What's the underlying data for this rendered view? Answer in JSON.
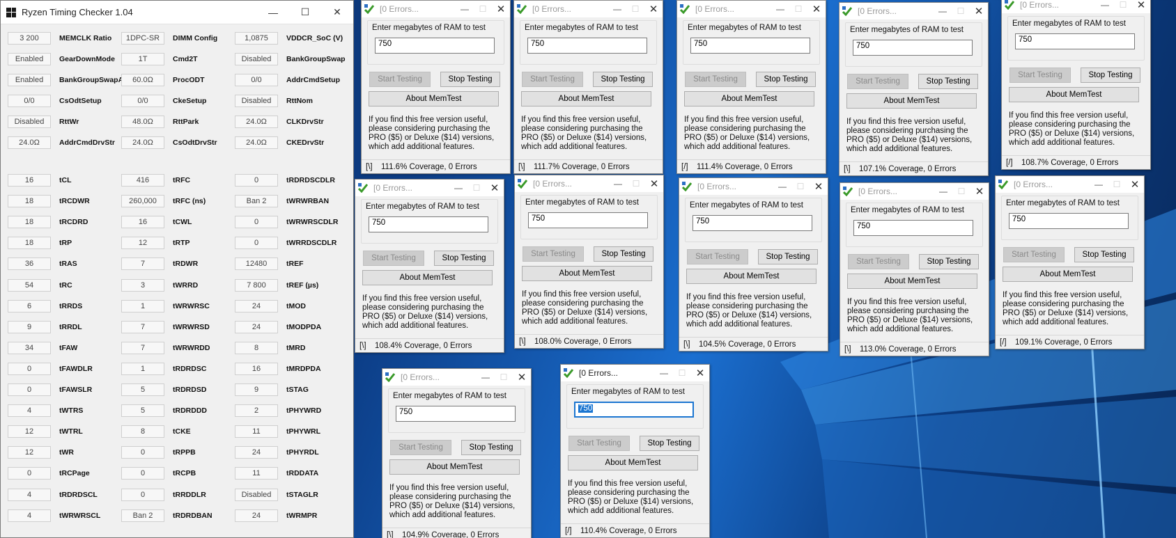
{
  "rtc": {
    "title": "Ryzen Timing Checker 1.04",
    "controls": {
      "minimize": "—",
      "maximize": "☐",
      "close": "✕"
    },
    "top_rows": [
      [
        {
          "v": "3 200",
          "n": "MEMCLK Ratio"
        },
        {
          "v": "1DPC-SR",
          "n": "DIMM Config"
        },
        {
          "v": "1,0875",
          "n": "VDDCR_SoC (V)"
        }
      ],
      [
        {
          "v": "Enabled",
          "n": "GearDownMode"
        },
        {
          "v": "1T",
          "n": "Cmd2T"
        },
        {
          "v": "Disabled",
          "n": "BankGroupSwap"
        }
      ],
      [
        {
          "v": "Enabled",
          "n": "BankGroupSwapAlt"
        },
        {
          "v": "60.0Ω",
          "n": "ProcODT"
        },
        {
          "v": "0/0",
          "n": "AddrCmdSetup"
        }
      ],
      [
        {
          "v": "0/0",
          "n": "CsOdtSetup"
        },
        {
          "v": "0/0",
          "n": "CkeSetup"
        },
        {
          "v": "Disabled",
          "n": "RttNom"
        }
      ],
      [
        {
          "v": "Disabled",
          "n": "RttWr"
        },
        {
          "v": "48.0Ω",
          "n": "RttPark"
        },
        {
          "v": "24.0Ω",
          "n": "CLKDrvStr"
        }
      ],
      [
        {
          "v": "24.0Ω",
          "n": "AddrCmdDrvStr"
        },
        {
          "v": "24.0Ω",
          "n": "CsOdtDrvStr"
        },
        {
          "v": "24.0Ω",
          "n": "CKEDrvStr"
        }
      ]
    ],
    "timing_rows": [
      [
        {
          "v": "16",
          "n": "tCL"
        },
        {
          "v": "416",
          "n": "tRFC"
        },
        {
          "v": "0",
          "n": "tRDRDSCDLR"
        }
      ],
      [
        {
          "v": "18",
          "n": "tRCDWR"
        },
        {
          "v": "260,000",
          "n": "tRFC (ns)"
        },
        {
          "v": "Ban 2",
          "n": "tWRWRBAN"
        }
      ],
      [
        {
          "v": "18",
          "n": "tRCDRD"
        },
        {
          "v": "16",
          "n": "tCWL"
        },
        {
          "v": "0",
          "n": "tWRWRSCDLR"
        }
      ],
      [
        {
          "v": "18",
          "n": "tRP"
        },
        {
          "v": "12",
          "n": "tRTP"
        },
        {
          "v": "0",
          "n": "tWRRDSCDLR"
        }
      ],
      [
        {
          "v": "36",
          "n": "tRAS"
        },
        {
          "v": "7",
          "n": "tRDWR"
        },
        {
          "v": "12480",
          "n": "tREF"
        }
      ],
      [
        {
          "v": "54",
          "n": "tRC"
        },
        {
          "v": "3",
          "n": "tWRRD"
        },
        {
          "v": "7 800",
          "n": "tREF (µs)"
        }
      ],
      [
        {
          "v": "6",
          "n": "tRRDS"
        },
        {
          "v": "1",
          "n": "tWRWRSC"
        },
        {
          "v": "24",
          "n": "tMOD"
        }
      ],
      [
        {
          "v": "9",
          "n": "tRRDL"
        },
        {
          "v": "7",
          "n": "tWRWRSD"
        },
        {
          "v": "24",
          "n": "tMODPDA"
        }
      ],
      [
        {
          "v": "34",
          "n": "tFAW"
        },
        {
          "v": "7",
          "n": "tWRWRDD"
        },
        {
          "v": "8",
          "n": "tMRD"
        }
      ],
      [
        {
          "v": "0",
          "n": "tFAWDLR"
        },
        {
          "v": "1",
          "n": "tRDRDSC"
        },
        {
          "v": "16",
          "n": "tMRDPDA"
        }
      ],
      [
        {
          "v": "0",
          "n": "tFAWSLR"
        },
        {
          "v": "5",
          "n": "tRDRDSD"
        },
        {
          "v": "9",
          "n": "tSTAG"
        }
      ],
      [
        {
          "v": "4",
          "n": "tWTRS"
        },
        {
          "v": "5",
          "n": "tRDRDDD"
        },
        {
          "v": "2",
          "n": "tPHYWRD"
        }
      ],
      [
        {
          "v": "12",
          "n": "tWTRL"
        },
        {
          "v": "8",
          "n": "tCKE"
        },
        {
          "v": "11",
          "n": "tPHYWRL"
        }
      ],
      [
        {
          "v": "12",
          "n": "tWR"
        },
        {
          "v": "0",
          "n": "tRPPB"
        },
        {
          "v": "24",
          "n": "tPHYRDL"
        }
      ],
      [
        {
          "v": "0",
          "n": "tRCPage"
        },
        {
          "v": "0",
          "n": "tRCPB"
        },
        {
          "v": "11",
          "n": "tRDDATA"
        }
      ],
      [
        {
          "v": "4",
          "n": "tRDRDSCL"
        },
        {
          "v": "0",
          "n": "tRRDDLR"
        },
        {
          "v": "Disabled",
          "n": "tSTAGLR"
        }
      ],
      [
        {
          "v": "4",
          "n": "tWRWRSCL"
        },
        {
          "v": "Ban 2",
          "n": "tRDRDBAN"
        },
        {
          "v": "24",
          "n": "tWRMPR"
        }
      ]
    ]
  },
  "memtest_common": {
    "title": "[0 Errors...",
    "prompt": "Enter megabytes of RAM to test",
    "start_label": "Start Testing",
    "stop_label": "Stop Testing",
    "about_label": "About MemTest",
    "info_text": "If you find this free version useful, please considering purchasing the PRO ($5) or Deluxe ($14) versions, which add additional features.",
    "controls": {
      "minimize": "—",
      "maximize": "☐",
      "close": "✕"
    }
  },
  "memtests": [
    {
      "ram": "750",
      "spin": "[\\]",
      "coverage": "111.6% Coverage, 0 Errors"
    },
    {
      "ram": "750",
      "spin": "[\\]",
      "coverage": "111.7% Coverage, 0 Errors"
    },
    {
      "ram": "750",
      "spin": "[/]",
      "coverage": "111.4% Coverage, 0 Errors"
    },
    {
      "ram": "750",
      "spin": "[\\]",
      "coverage": "107.1% Coverage, 0 Errors"
    },
    {
      "ram": "750",
      "spin": "[/]",
      "coverage": "108.7% Coverage, 0 Errors"
    },
    {
      "ram": "750",
      "spin": "[\\]",
      "coverage": "108.4% Coverage, 0 Errors"
    },
    {
      "ram": "750",
      "spin": "[\\]",
      "coverage": "108.0% Coverage, 0 Errors"
    },
    {
      "ram": "750",
      "spin": "[\\]",
      "coverage": "104.5% Coverage, 0 Errors"
    },
    {
      "ram": "750",
      "spin": "[\\]",
      "coverage": "113.0% Coverage, 0 Errors"
    },
    {
      "ram": "750",
      "spin": "[/]",
      "coverage": "109.1% Coverage, 0 Errors"
    },
    {
      "ram": "750",
      "spin": "[\\]",
      "coverage": "104.9% Coverage, 0 Errors"
    },
    {
      "ram": "750",
      "spin": "[/]",
      "coverage": "110.4% Coverage, 0 Errors",
      "active": true
    }
  ],
  "colors": {
    "desktop": "#0c3d86",
    "selection": "#1a75d1",
    "window_bg": "#f0f0f0"
  }
}
